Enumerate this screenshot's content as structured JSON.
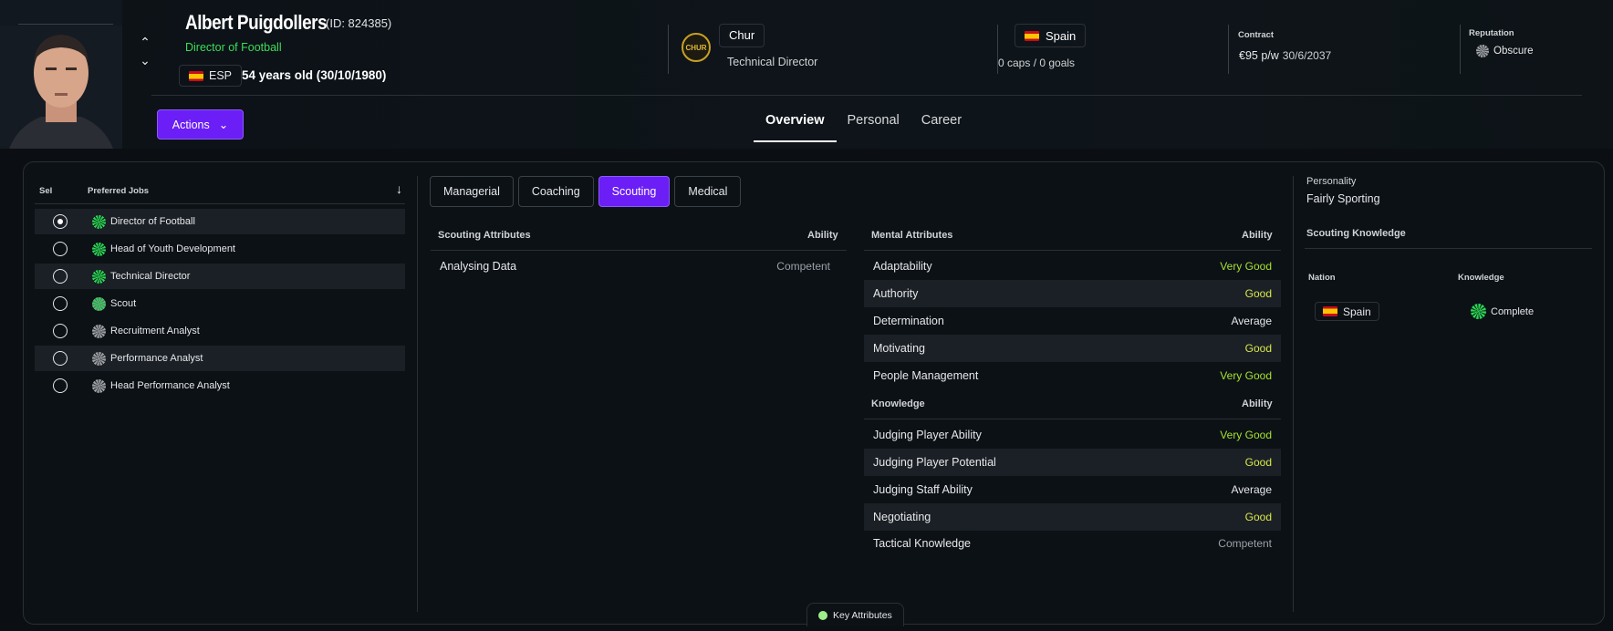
{
  "person": {
    "name": "Albert Puigdollers",
    "id_text": "(ID: 824385)",
    "role": "Director of Football",
    "nationality_code": "ESP",
    "age_text": "54 years old (30/10/1980)"
  },
  "club": {
    "name": "Chur",
    "badge_text": "CHUR",
    "role": "Technical Director"
  },
  "international": {
    "country": "Spain",
    "caps_text": "0 caps / 0 goals"
  },
  "contract": {
    "label": "Contract",
    "wage": "€95 p/w",
    "expiry": "30/6/2037"
  },
  "reputation": {
    "label": "Reputation",
    "value": "Obscure"
  },
  "actions_label": "Actions",
  "main_tabs": [
    "Overview",
    "Personal",
    "Career"
  ],
  "jobs": {
    "header_sel": "Sel",
    "header_jobs": "Preferred Jobs",
    "items": [
      {
        "label": "Director of Football",
        "selected": true,
        "icon": "green"
      },
      {
        "label": "Head of Youth Development",
        "selected": false,
        "icon": "green"
      },
      {
        "label": "Technical Director",
        "selected": false,
        "icon": "green"
      },
      {
        "label": "Scout",
        "selected": false,
        "icon": "gray"
      },
      {
        "label": "Recruitment Analyst",
        "selected": false,
        "icon": "gray"
      },
      {
        "label": "Performance Analyst",
        "selected": false,
        "icon": "gray"
      },
      {
        "label": "Head Performance Analyst",
        "selected": false,
        "icon": "gray"
      }
    ]
  },
  "attr_tabs": [
    "Managerial",
    "Coaching",
    "Scouting",
    "Medical"
  ],
  "active_attr_tab": "Scouting",
  "scouting": {
    "header": "Scouting Attributes",
    "ability_header": "Ability",
    "rows": [
      {
        "name": "Analysing Data",
        "value": "Competent"
      }
    ]
  },
  "mental": {
    "header": "Mental Attributes",
    "ability_header": "Ability",
    "rows": [
      {
        "name": "Adaptability",
        "value": "Very Good"
      },
      {
        "name": "Authority",
        "value": "Good"
      },
      {
        "name": "Determination",
        "value": "Average"
      },
      {
        "name": "Motivating",
        "value": "Good"
      },
      {
        "name": "People Management",
        "value": "Very Good"
      }
    ]
  },
  "knowledge": {
    "header": "Knowledge",
    "ability_header": "Ability",
    "rows": [
      {
        "name": "Judging Player Ability",
        "value": "Very Good"
      },
      {
        "name": "Judging Player Potential",
        "value": "Good"
      },
      {
        "name": "Judging Staff Ability",
        "value": "Average"
      },
      {
        "name": "Negotiating",
        "value": "Good"
      },
      {
        "name": "Tactical Knowledge",
        "value": "Competent"
      }
    ]
  },
  "personality": {
    "label": "Personality",
    "value": "Fairly Sporting"
  },
  "scouting_knowledge": {
    "title": "Scouting Knowledge",
    "col_nation": "Nation",
    "col_knowledge": "Knowledge",
    "nation": "Spain",
    "knowledge": "Complete"
  },
  "key_attributes_label": "Key Attributes",
  "colors": {
    "accent": "#6b1ef5",
    "role_green": "#3ddc5a",
    "very_good": "#a6e22e",
    "good": "#d7e84a"
  }
}
